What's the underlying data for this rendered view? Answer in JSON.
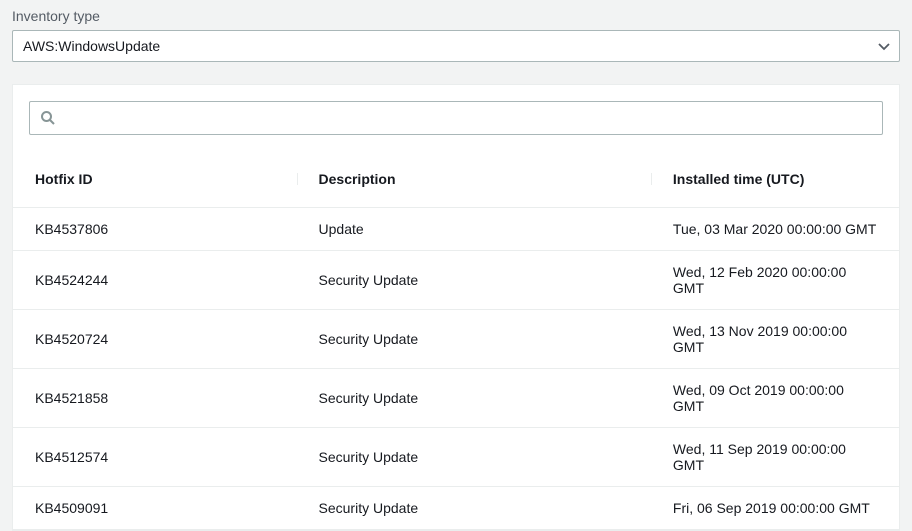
{
  "inventory": {
    "label": "Inventory type",
    "selected": "AWS:WindowsUpdate"
  },
  "search": {
    "placeholder": ""
  },
  "table": {
    "headers": {
      "hotfix": "Hotfix ID",
      "description": "Description",
      "installed": "Installed time (UTC)"
    },
    "rows": [
      {
        "hotfix": "KB4537806",
        "description": "Update",
        "installed": "Tue, 03 Mar 2020 00:00:00 GMT"
      },
      {
        "hotfix": "KB4524244",
        "description": "Security Update",
        "installed": "Wed, 12 Feb 2020 00:00:00 GMT"
      },
      {
        "hotfix": "KB4520724",
        "description": "Security Update",
        "installed": "Wed, 13 Nov 2019 00:00:00 GMT"
      },
      {
        "hotfix": "KB4521858",
        "description": "Security Update",
        "installed": "Wed, 09 Oct 2019 00:00:00 GMT"
      },
      {
        "hotfix": "KB4512574",
        "description": "Security Update",
        "installed": "Wed, 11 Sep 2019 00:00:00 GMT"
      },
      {
        "hotfix": "KB4509091",
        "description": "Security Update",
        "installed": "Fri, 06 Sep 2019 00:00:00 GMT"
      }
    ]
  }
}
